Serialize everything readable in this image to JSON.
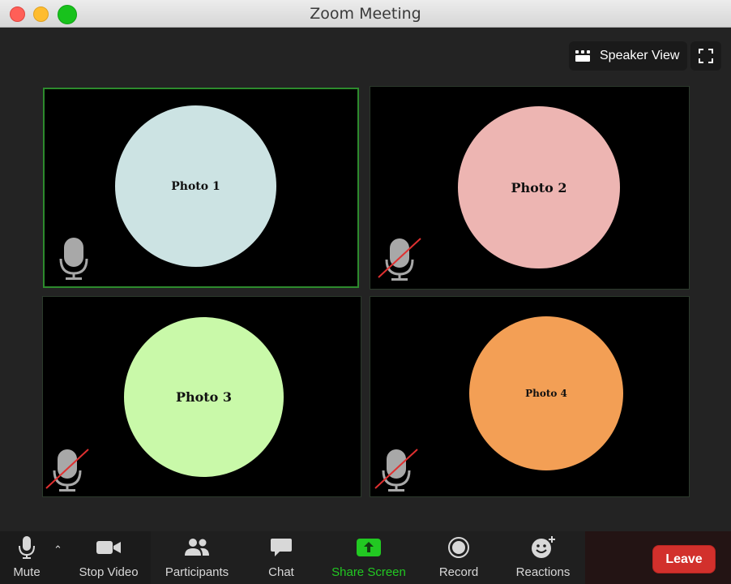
{
  "window": {
    "title": "Zoom Meeting"
  },
  "top_controls": {
    "speaker_view_label": "Speaker View"
  },
  "tiles": [
    {
      "photo_label": "Photo 1",
      "color": "#cce3e3",
      "mic_muted": false,
      "active_speaker": true
    },
    {
      "photo_label": "Photo 2",
      "color": "#edb5b2",
      "mic_muted": true,
      "active_speaker": false
    },
    {
      "photo_label": "Photo 3",
      "color": "#c9f9a9",
      "mic_muted": true,
      "active_speaker": false
    },
    {
      "photo_label": "Photo 4",
      "color": "#f39f55",
      "mic_muted": true,
      "active_speaker": false
    }
  ],
  "toolbar": {
    "mute_label": "Mute",
    "stop_video_label": "Stop Video",
    "participants_label": "Participants",
    "chat_label": "Chat",
    "share_screen_label": "Share Screen",
    "record_label": "Record",
    "reactions_label": "Reactions",
    "leave_label": "Leave"
  },
  "colors": {
    "accent_green": "#22c922",
    "leave_red": "#d2302c",
    "active_border": "#2d8a2d"
  }
}
